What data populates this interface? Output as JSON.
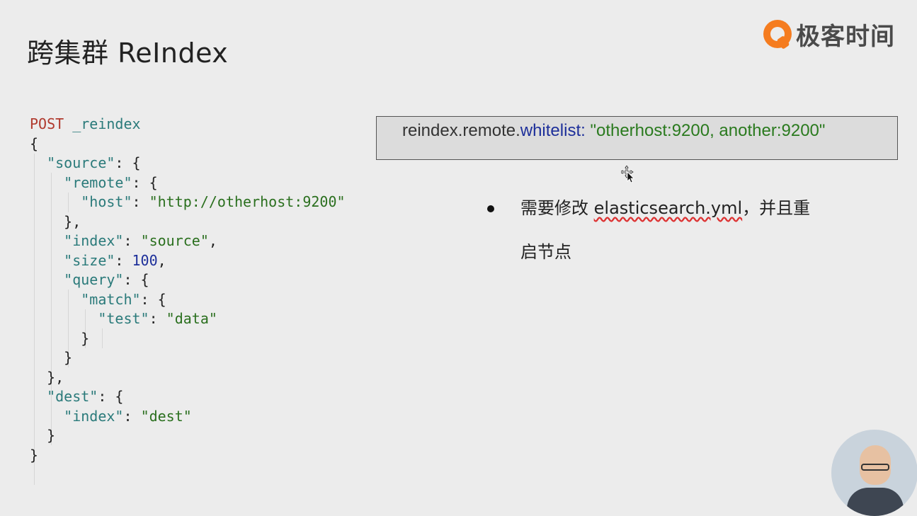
{
  "slide": {
    "title": "跨集群 ReIndex",
    "logo_text": "极客时间",
    "brand_color": "#f57c1f"
  },
  "code": {
    "method": "POST",
    "path": "_reindex",
    "lines": [
      "{",
      "  \"source\": {",
      "    \"remote\": {",
      "      \"host\": \"http://otherhost:9200\"",
      "    },",
      "    \"index\": \"source\",",
      "    \"size\": 100,",
      "    \"query\": {",
      "      \"match\": {",
      "        \"test\": \"data\"",
      "      }",
      "    }",
      "  },",
      "  \"dest\": {",
      "    \"index\": \"dest\"",
      "  }",
      "}"
    ]
  },
  "config": {
    "key_prefix": "reindex.remote.",
    "key_name": "whitelist:",
    "value": " \"otherhost:9200, another:9200\""
  },
  "note": {
    "prefix": "需要修改 ",
    "filename": "elasticsearch.yml",
    "suffix": "，并且重",
    "line2": "启节点"
  },
  "presenter": {
    "icon": "presenter-video-thumbnail"
  }
}
